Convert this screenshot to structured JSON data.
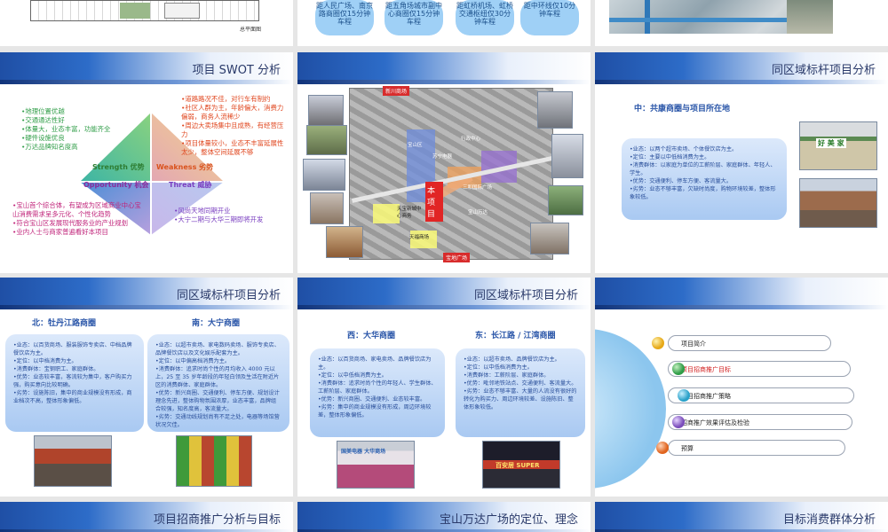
{
  "slides": {
    "s1_plan_label": "总平面图",
    "s2_pills": [
      "距人民广场、南京路商圈仅15分钟车程",
      "距五角场城市副中心商圈仅15分钟车程",
      "距虹桥机场、虹桥交通枢纽仅30分钟车程",
      "距中环线仅10分钟车程"
    ],
    "swot": {
      "title": "项目 SWOT 分析",
      "strengths": [
        "•地理位置优越",
        "•交通通达性好",
        "•体量大，业态丰富，功能齐全",
        "•硬件设施优良",
        "•万达品牌知名度高"
      ],
      "weaknesses": [
        "•道路路况不佳，对行车有制约",
        "•社区人群为主，年龄偏大，消费力偏弱，商务人流稀少",
        "•周边大卖场集中且成熟，有经营压力",
        "•项目体量较小，业态不丰富延展性太少，整体空间延展不够"
      ],
      "opportunities": [
        "•宝山首个综合体，有望成为区域商业中心宝山消费需求呈多元化、个性化趋势",
        "•符合宝山区发展现代服务业的产业规划",
        "•业内人士与商家普遍看好本项目"
      ],
      "threats": [
        "•风尚天地同期开业",
        "•大宁二期与大华三期即将开发"
      ],
      "label_s": "Strength 优势",
      "label_w": "Weakness 劣势",
      "label_o": "Opportunity 机会",
      "label_t": "Threat 威胁"
    },
    "map": {
      "labels": [
        "新川商场",
        "行政中心",
        "宝山区",
        "三和国际广场",
        "天宝新城中心商务",
        "本项目",
        "宝山万达",
        "天福商场",
        "苏宁电器",
        "宝地广场"
      ]
    },
    "bench1": {
      "title": "同区域标杆项目分析",
      "subtitle": "中：共康商圈与项目所在地",
      "lines": [
        "•业态：以两个超市卖场、个体餐饮店为主。",
        "•定位：主要以中低档消费为主。",
        "•消费群体：以家庭为单位的工薪阶层、家庭群体、年轻人、学生。",
        "•优势：交通便利、停车方便、客流量大。",
        "•劣势：业态不够丰富，欠缺时尚度，购物环境较差，整体形象较低。"
      ],
      "sign_text": "好 美 家"
    },
    "bench2": {
      "title": "同区域标杆项目分析",
      "north_title": "北：牡丹江路商圈",
      "south_title": "南：大宁商圈",
      "north_lines": [
        "•业态：以百货商场、服装服饰专卖店、中档品牌餐饮店为主。",
        "•定位：以中档消费为主。",
        "•消费群体：宝钢职工、家庭群体。",
        "•优势：业态较丰富，客流较为集中，客户购买力强，购买意向比较明确。",
        "•劣势：设施陈旧，集中的商业规模没有形成，商业档次不高，整体形象偏低。"
      ],
      "south_lines": [
        "•业态：以超市卖场、家电数码卖场、服饰专卖店、品牌餐饮店以及文化娱乐配套为主。",
        "•定位：以中偏高档消费为主。",
        "•消费群体：追求时尚个性的月均收入 4000 元以上，25 至 35 岁年龄段的年轻白领及生活在附近片区的消费群体、家庭群体。",
        "•优势：新兴商圈、交通便利、停车方便、规划设计理念先进，整体购物氛围浓厚，业态丰富，品牌组合较强，知名度高，客流量大。",
        "•劣势：交通动线规划尚有不足之处，电器等场馆营状况欠佳。"
      ]
    },
    "bench3": {
      "title": "同区域标杆项目分析",
      "west_title": "西：大华商圈",
      "east_title": "东：长江路 / 江湾商圈",
      "west_lines": [
        "•业态：以百货商场、家电卖场、品牌餐饮店为主。",
        "•定位：以中低档消费为主。",
        "•消费群体：追求时尚个性的年轻人、学生群体、工薪阶层、家庭群体。",
        "•优势：新兴商圈、交通便利、业态较丰富。",
        "•劣势：集中的商业规模没有形成，周边环境较差，整体形象偏低。"
      ],
      "east_lines": [
        "•业态：以超市卖场、品牌餐饮店为主。",
        "•定位：以中低档消费为主。",
        "•消费群体：工薪阶层、家庭群体。",
        "•优势：毗邻地铁站点、交通便利、客流量大。",
        "•劣势：业态不够丰富、大量的人流没有很好的转化为购买力、周边环境较差、设施陈旧、整体形象较低。"
      ],
      "west_sign": "国美电器 大华商场",
      "east_sign": "百安居 SUPER"
    },
    "agenda": {
      "items": [
        "项目简介",
        "项目招商推广目标",
        "项目招商推广策略",
        "招商推广效果评估及检验",
        "预算"
      ],
      "dot_colors": [
        "#e6a817",
        "#2f9d47",
        "#2aa1c9",
        "#7a4dbb",
        "#e0641e"
      ],
      "active_index": 1
    },
    "bottom_titles": [
      "项目招商推广分析与目标",
      "宝山万达广场的定位、理念",
      "目标消费群体分析"
    ]
  }
}
